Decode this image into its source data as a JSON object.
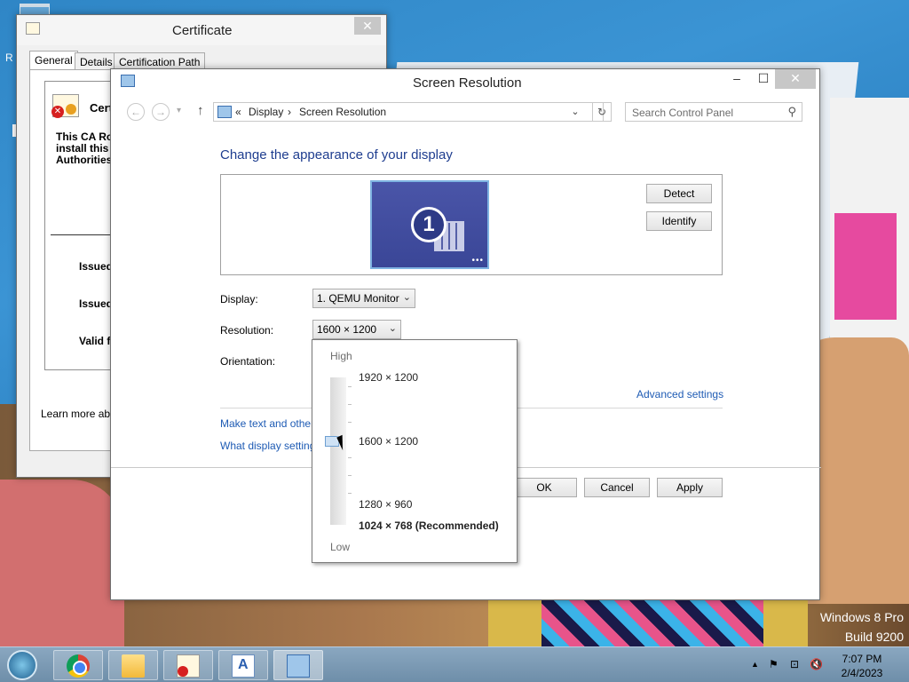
{
  "desktop": {
    "letter": "R",
    "watermark_line1": "Windows 8 Pro",
    "watermark_line2": "Build 9200"
  },
  "certificate_window": {
    "title": "Certificate",
    "close_glyph": "✕",
    "tabs": [
      "General",
      "Details",
      "Certification Path"
    ],
    "header_text": "Certi",
    "warning_lines": [
      "This CA Roo",
      "install this c",
      "Authorities"
    ],
    "fields": [
      "Issued",
      "Issued",
      "Valid fr"
    ],
    "learn_more": "Learn more abou"
  },
  "screen_resolution_window": {
    "title": "Screen Resolution",
    "minimize_glyph": "–",
    "maximize_glyph": "☐",
    "close_glyph": "✕",
    "nav": {
      "back_glyph": "←",
      "forward_glyph": "→",
      "history_glyph": "▾",
      "up_glyph": "↑",
      "breadcrumb_prefix": "«",
      "breadcrumb": [
        "Display",
        "Screen Resolution"
      ],
      "breadcrumb_sep": "›",
      "dropdown_glyph": "⌄",
      "refresh_glyph": "↻",
      "search_placeholder": "Search Control Panel",
      "search_glyph": "⚲"
    },
    "heading": "Change the appearance of your display",
    "monitor_number": "1",
    "monitor_dots": "•••",
    "buttons": {
      "detect": "Detect",
      "identify": "Identify",
      "ok": "OK",
      "cancel": "Cancel",
      "apply": "Apply"
    },
    "display_label": "Display:",
    "display_value": "1. QEMU Monitor",
    "resolution_label": "Resolution:",
    "resolution_value": "1600 × 1200",
    "orientation_label": "Orientation:",
    "combo_arrow": "⌄",
    "advanced_settings": "Advanced settings",
    "link_text_size": "Make text and other",
    "link_display_settings": "What display setting"
  },
  "resolution_popup": {
    "high_label": "High",
    "low_label": "Low",
    "options": [
      "1920 × 1200",
      "1600 × 1200",
      "1280 × 960",
      "1024 × 768 (Recommended)"
    ],
    "selected": "1600 × 1200",
    "slider_level": 0.4
  },
  "taskbar": {
    "tray_up": "▲",
    "tray_flag": "⚑",
    "tray_network": "⊡",
    "tray_volume": "🔇",
    "time": "7:07 PM",
    "date": "2/4/2023"
  }
}
